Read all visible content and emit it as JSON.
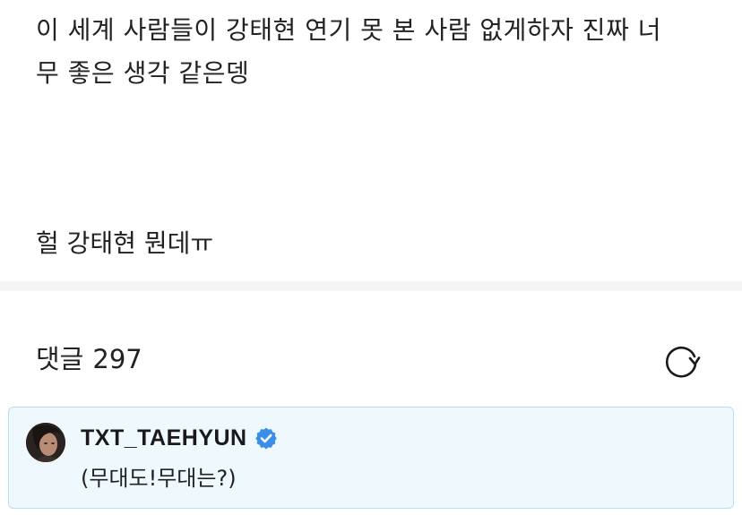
{
  "post": {
    "lines": [
      "이 세계 사람들이 강태현 연기 못 본 사람 없게하자 진짜 너",
      "무 좋은 생각 같은뎅"
    ],
    "reply_line": "헐 강태현 뭔데ㅠ"
  },
  "comments": {
    "label": "댓글",
    "count": "297",
    "refresh_icon": "refresh-icon"
  },
  "comment": {
    "author": "TXT_TAEHYUN",
    "verified_icon": "verified-badge-icon",
    "text": "(무대도!무대는?)"
  },
  "colors": {
    "divider": "#f3f4f6",
    "highlight_bg": "#eef8fd",
    "highlight_border": "#b8dff2",
    "verified": "#3a8ee6"
  }
}
